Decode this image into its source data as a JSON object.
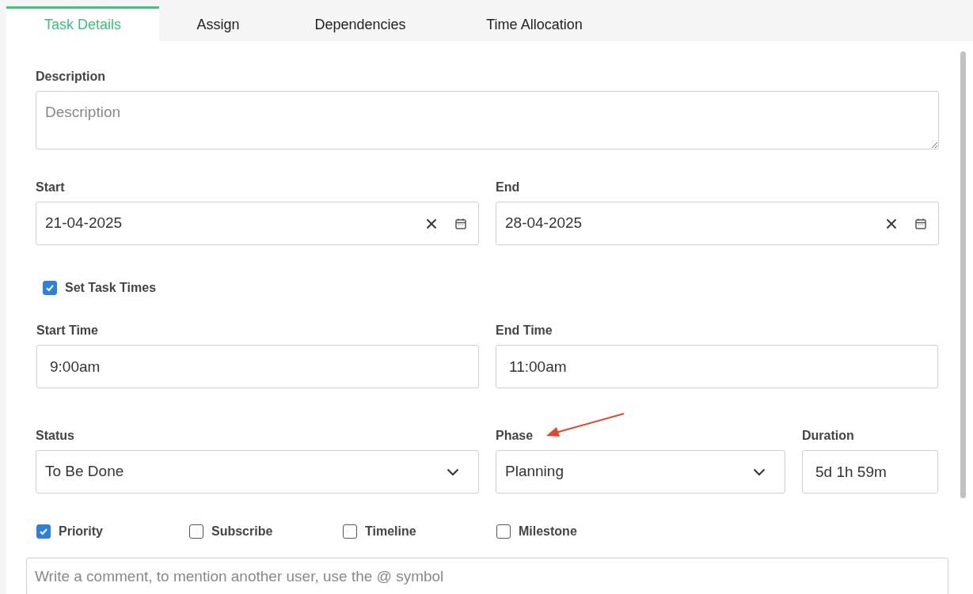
{
  "tabs": [
    {
      "label": "Task Details",
      "selected": true
    },
    {
      "label": "Assign",
      "selected": false
    },
    {
      "label": "Dependencies",
      "selected": false
    },
    {
      "label": "Time Allocation",
      "selected": false
    }
  ],
  "description": {
    "label": "Description",
    "placeholder": "Description"
  },
  "date_row": [
    {
      "kind": "date",
      "label": "Start",
      "value": "21-04-2025"
    },
    {
      "kind": "date",
      "label": "End",
      "value": "28-04-2025"
    }
  ],
  "set_task_times": {
    "label": "Set Task Times",
    "checked": true
  },
  "time_row": [
    {
      "kind": "text",
      "label": "Start Time",
      "value": "9:00am"
    },
    {
      "kind": "text",
      "label": "End Time",
      "value": "11:00am"
    }
  ],
  "status_row": [
    {
      "kind": "select",
      "label": "Status",
      "value": "To Be Done"
    },
    {
      "kind": "select",
      "label": "Phase",
      "value": "Planning"
    },
    {
      "kind": "text",
      "label": "Duration",
      "value": "5d 1h 59m"
    }
  ],
  "options": [
    {
      "label": "Priority",
      "checked": true
    },
    {
      "label": "Subscribe",
      "checked": false
    },
    {
      "label": "Timeline",
      "checked": false
    },
    {
      "label": "Milestone",
      "checked": false
    }
  ],
  "comment": {
    "placeholder": "Write a comment, to mention another user, use the @ symbol"
  }
}
